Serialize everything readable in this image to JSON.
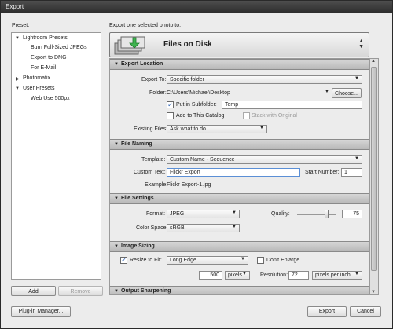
{
  "window": {
    "title": "Export"
  },
  "preset_label": "Preset:",
  "export_header": "Export one selected photo to:",
  "presets": {
    "groups": [
      {
        "label": "Lightroom Presets",
        "expanded": true,
        "items": [
          "Burn Full-Sized JPEGs",
          "Export to DNG",
          "For E-Mail"
        ]
      },
      {
        "label": "Photomatix",
        "expanded": false,
        "items": []
      },
      {
        "label": "User Presets",
        "expanded": true,
        "items": [
          "Web Use 500px"
        ]
      }
    ],
    "add_label": "Add",
    "remove_label": "Remove"
  },
  "destination": {
    "title": "Files on Disk",
    "icon": "folder-disk-icon"
  },
  "sections": {
    "export_location": {
      "title": "Export Location",
      "export_to_label": "Export To:",
      "export_to_value": "Specific folder",
      "folder_label": "Folder:",
      "folder_value": "C:\\Users\\Michael\\Desktop",
      "choose_label": "Choose...",
      "subfolder_label": "Put in Subfolder:",
      "subfolder_checked": true,
      "subfolder_value": "Temp",
      "add_catalog_label": "Add to This Catalog",
      "add_catalog_checked": false,
      "stack_label": "Stack with Original",
      "stack_checked": false,
      "existing_label": "Existing Files:",
      "existing_value": "Ask what to do"
    },
    "file_naming": {
      "title": "File Naming",
      "template_label": "Template:",
      "template_value": "Custom Name - Sequence",
      "custom_text_label": "Custom Text:",
      "custom_text_value": "Flickr Export",
      "start_number_label": "Start Number:",
      "start_number_value": "1",
      "example_label": "Example:",
      "example_value": "Flickr Export-1.jpg"
    },
    "file_settings": {
      "title": "File Settings",
      "format_label": "Format:",
      "format_value": "JPEG",
      "quality_label": "Quality:",
      "quality_value": "75",
      "quality_fraction": 0.75,
      "color_space_label": "Color Space:",
      "color_space_value": "sRGB"
    },
    "image_sizing": {
      "title": "Image Sizing",
      "resize_label": "Resize to Fit:",
      "resize_checked": true,
      "resize_value": "Long Edge",
      "dont_enlarge_label": "Don't Enlarge",
      "dont_enlarge_checked": false,
      "size_value": "500",
      "size_unit": "pixels",
      "resolution_label": "Resolution:",
      "resolution_value": "72",
      "resolution_unit": "pixels per inch"
    },
    "output_sharpening": {
      "title": "Output Sharpening"
    }
  },
  "footer": {
    "plugin_manager_label": "Plug-in Manager...",
    "export_label": "Export",
    "cancel_label": "Cancel"
  }
}
